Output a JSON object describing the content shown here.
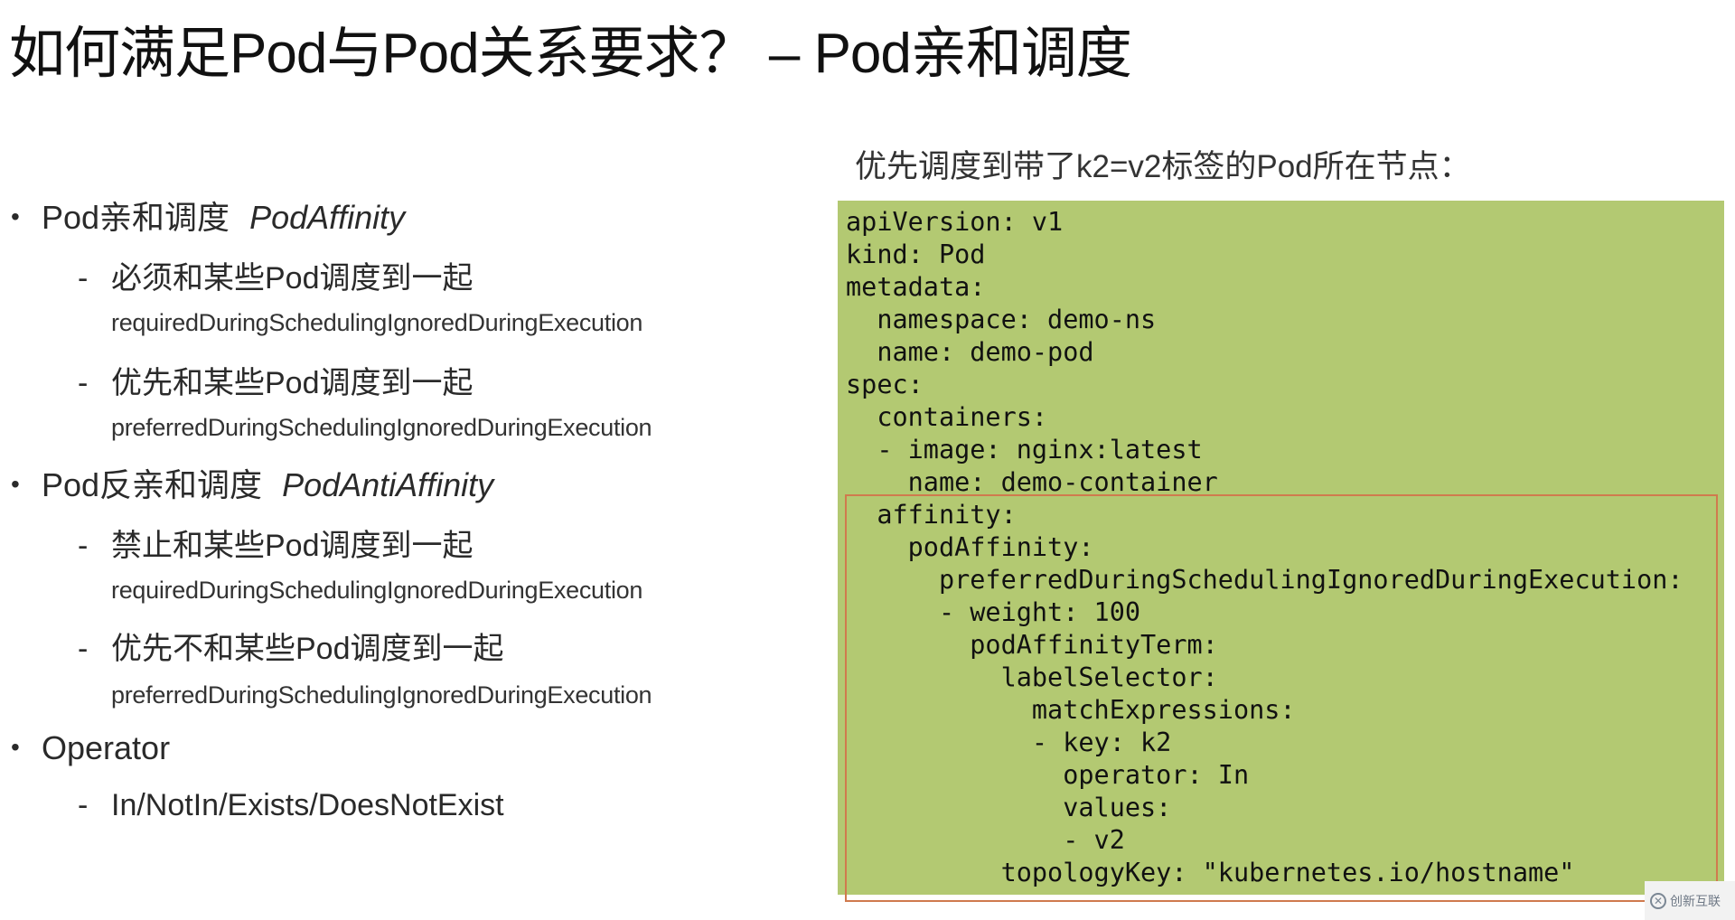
{
  "title": "如何满足Pod与Pod关系要求？  – Pod亲和调度",
  "left": {
    "bullets": [
      {
        "label": "Pod亲和调度",
        "en": "PodAffinity",
        "subs": [
          {
            "text": "必须和某些Pod调度到一起",
            "term": "requiredDuringSchedulingIgnoredDuringExecution"
          },
          {
            "text": "优先和某些Pod调度到一起",
            "term": "preferredDuringSchedulingIgnoredDuringExecution"
          }
        ]
      },
      {
        "label": "Pod反亲和调度",
        "en": "PodAntiAffinity",
        "subs": [
          {
            "text": "禁止和某些Pod调度到一起",
            "term": "requiredDuringSchedulingIgnoredDuringExecution"
          },
          {
            "text": "优先不和某些Pod调度到一起",
            "term": "preferredDuringSchedulingIgnoredDuringExecution"
          }
        ]
      },
      {
        "label": "Operator",
        "en": "",
        "subs": [
          {
            "text": "In/NotIn/Exists/DoesNotExist",
            "term": ""
          }
        ]
      }
    ],
    "bullet_glyph": "•",
    "dash_glyph": "-"
  },
  "right": {
    "caption": "优先调度到带了k2=v2标签的Pod所在节点：",
    "yaml": [
      "apiVersion: v1",
      "kind: Pod",
      "metadata:",
      "  namespace: demo-ns",
      "  name: demo-pod",
      "spec:",
      "  containers:",
      "  - image: nginx:latest",
      "    name: demo-container",
      "  affinity:",
      "    podAffinity:",
      "      preferredDuringSchedulingIgnoredDuringExecution:",
      "      - weight: 100",
      "        podAffinityTerm:",
      "          labelSelector:",
      "            matchExpressions:",
      "            - key: k2",
      "              operator: In",
      "              values:",
      "              - v2",
      "          topologyKey: \"kubernetes.io/hostname\""
    ],
    "box_color": "#b3c972",
    "highlight_color": "#d07a4e"
  },
  "watermark": {
    "logo": "✕",
    "text": "创新互联"
  }
}
